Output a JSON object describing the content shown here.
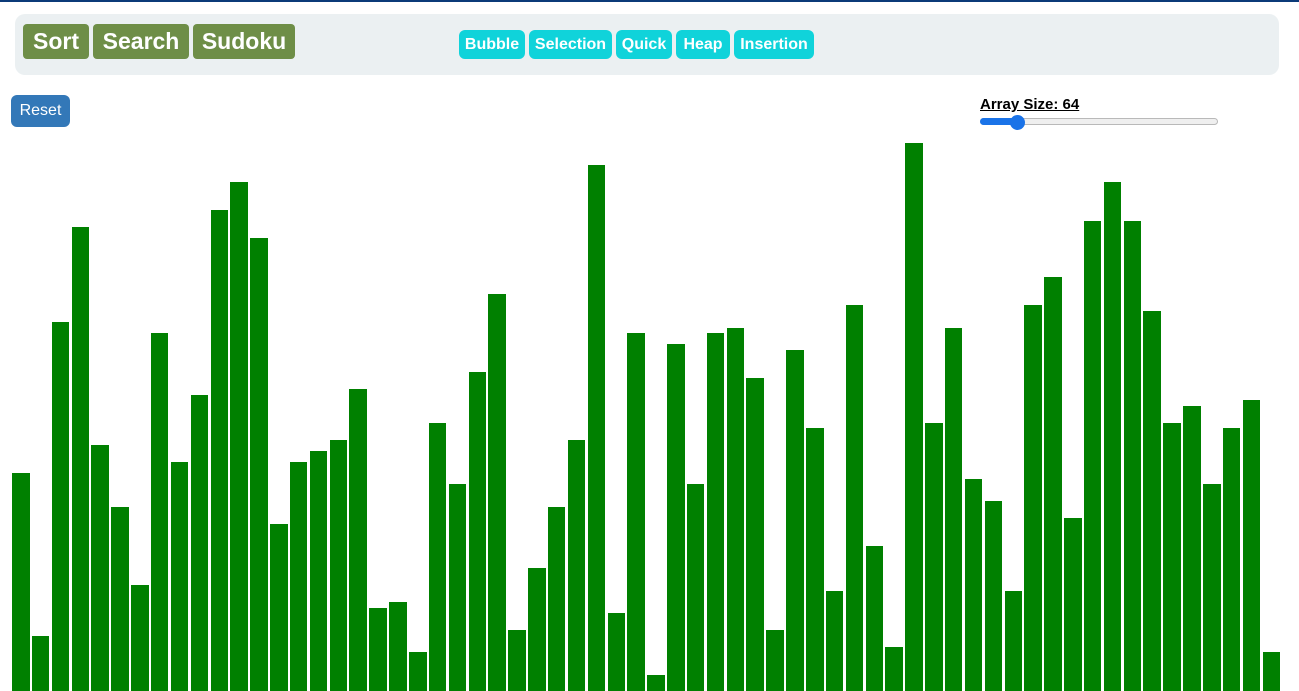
{
  "nav": {
    "modes": [
      "Sort",
      "Search",
      "Sudoku"
    ],
    "algorithms": [
      "Bubble",
      "Selection",
      "Quick",
      "Heap",
      "Insertion"
    ]
  },
  "controls": {
    "reset_label": "Reset",
    "array_size_label": "Array Size: 64",
    "array_size_value": 64,
    "array_size_slider_fraction": 0.155
  },
  "colors": {
    "navbar_bg": "#ebf0f2",
    "mode_button": "#6e8e47",
    "algo_button": "#10d3da",
    "reset_button": "#3378b8",
    "bar": "#008000",
    "slider_accent": "#1a73e8"
  },
  "array_values": [
    218,
    55,
    369,
    464,
    246,
    184,
    106,
    358,
    229,
    296,
    481,
    509,
    453,
    167,
    229,
    240,
    251,
    302,
    83,
    89,
    39,
    268,
    207,
    319,
    397,
    61,
    123,
    184,
    251,
    526,
    78,
    358,
    16,
    347,
    207,
    358,
    363,
    313,
    61,
    341,
    263,
    100,
    386,
    145,
    44,
    548,
    268,
    363,
    212,
    190,
    100,
    386,
    414,
    173,
    470,
    509,
    470,
    380,
    268,
    285,
    207,
    263,
    291,
    39
  ]
}
